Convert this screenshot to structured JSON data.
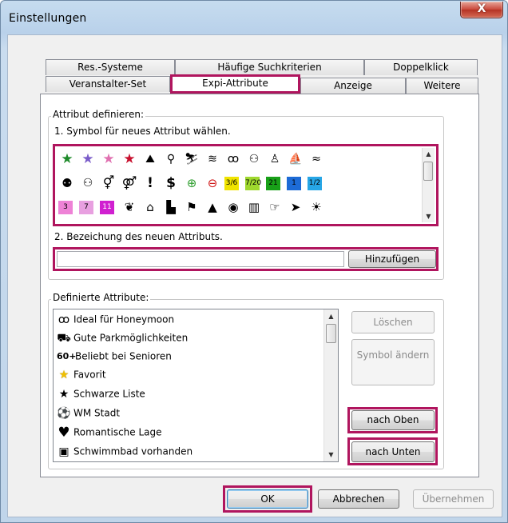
{
  "window": {
    "title": "Einstellungen",
    "close_label": "X"
  },
  "tabs": {
    "row_back": [
      "Res.-Systeme",
      "Häufige Suchkriterien",
      "Doppelklick"
    ],
    "row_front": [
      "Veranstalter-Set",
      "Expi-Attribute",
      "Anzeige",
      "Weitere"
    ],
    "active": "Expi-Attribute"
  },
  "define_group": {
    "label": "Attribut definieren:",
    "step1": "1. Symbol für neues Attribut wählen.",
    "step2": "2. Bezeichung des neuen Attributs.",
    "name_value": "",
    "add_button": "Hinzufügen",
    "icons_row1": [
      "star-green",
      "star-purple",
      "star-pink",
      "star-red",
      "climbing",
      "bicycle",
      "skiing",
      "swimming",
      "diving-mask",
      "hiking-group",
      "hiking",
      "boat",
      "waves"
    ],
    "icons_row2": [
      "family",
      "kids-family",
      "gender-symbols",
      "couple-symbols",
      "exclamation",
      "dollar",
      "plus-green",
      "minus-red",
      "number-3-6",
      "number-7-20",
      "number-21",
      "number-1-blue",
      "number-1-2"
    ],
    "icons_row3": [
      "number-3-pink",
      "number-7-pink",
      "number-11-magenta",
      "leaf",
      "house",
      "city",
      "flag",
      "house-dark",
      "camera",
      "building",
      "hand",
      "bird",
      "sun"
    ]
  },
  "defined_group": {
    "label": "Definierte Attribute:",
    "items": [
      {
        "icon": "rings-icon",
        "symbol": "ꝏ",
        "label": "Ideal für Honeymoon"
      },
      {
        "icon": "car-icon",
        "symbol": "⛟",
        "label": "Gute Parkmöglichkeiten"
      },
      {
        "icon": "seniors-icon",
        "symbol": "60+",
        "label": "Beliebt bei Senioren"
      },
      {
        "icon": "favorite-star-icon",
        "symbol": "★",
        "label": "Favorit"
      },
      {
        "icon": "black-star-icon",
        "symbol": "★",
        "label": "Schwarze Liste"
      },
      {
        "icon": "soccer-ball-icon",
        "symbol": "⚽",
        "label": "WM Stadt"
      },
      {
        "icon": "heart-icon",
        "symbol": "♥",
        "label": "Romantische Lage"
      },
      {
        "icon": "pool-icon",
        "symbol": "▣",
        "label": "Schwimmbad vorhanden"
      }
    ],
    "delete_button": "Löschen",
    "change_symbol_button": "Symbol ändern",
    "up_button": "nach Oben",
    "down_button": "nach Unten"
  },
  "footer": {
    "ok": "OK",
    "cancel": "Abbrechen",
    "apply": "Übernehmen"
  },
  "colors": {
    "highlight": "#b0155e",
    "titlebar": "#b9d1ea",
    "close": "#c9473a"
  }
}
